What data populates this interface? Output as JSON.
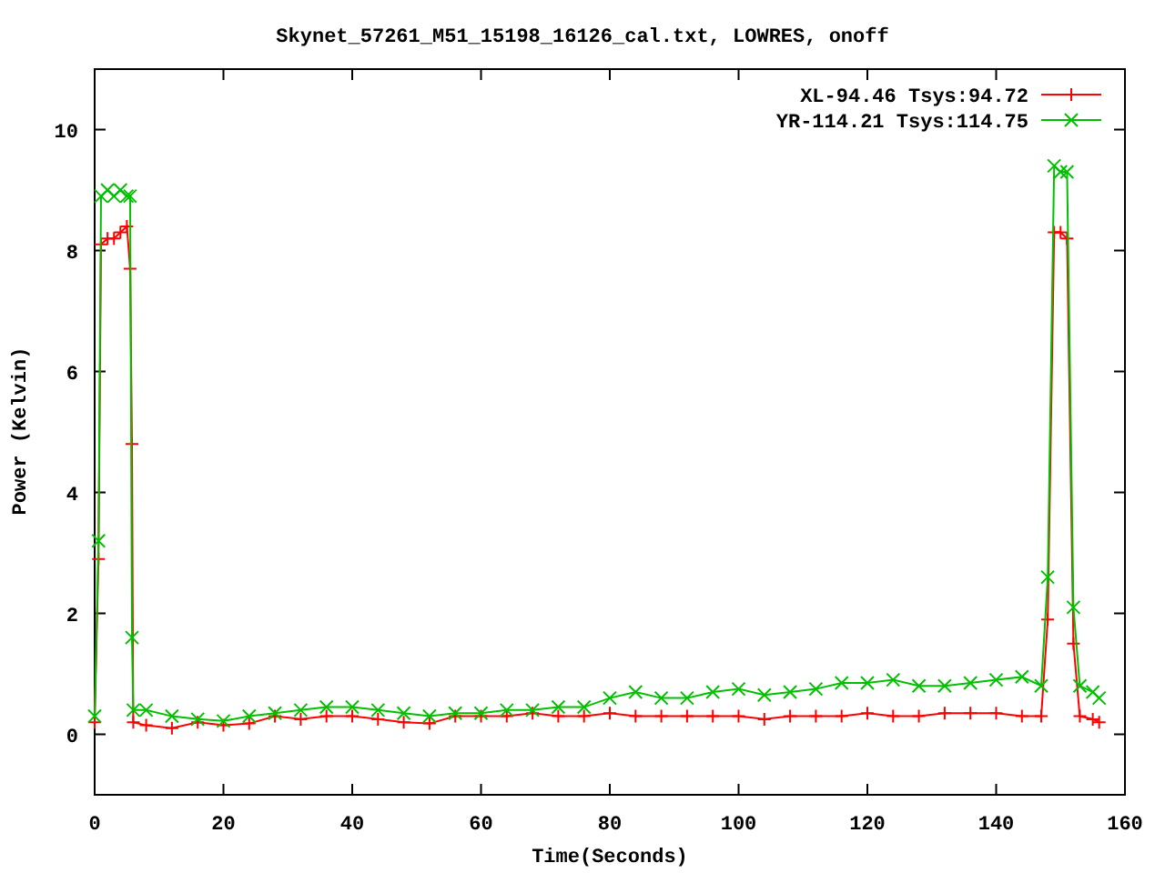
{
  "chart_data": {
    "type": "line",
    "title": "Skynet_57261_M51_15198_16126_cal.txt, LOWRES, onoff",
    "xlabel": "Time(Seconds)",
    "ylabel": "Power (Kelvin)",
    "x": [
      0,
      0.6,
      1,
      2,
      3,
      4,
      5,
      5.5,
      5.8,
      6,
      8,
      12,
      16,
      20,
      24,
      28,
      32,
      36,
      40,
      44,
      48,
      52,
      56,
      60,
      64,
      68,
      72,
      76,
      80,
      84,
      88,
      92,
      96,
      100,
      104,
      108,
      112,
      116,
      120,
      124,
      128,
      132,
      136,
      140,
      144,
      147,
      148,
      149,
      150,
      151,
      152,
      153,
      155,
      156
    ],
    "series": [
      {
        "name": "XL-94.46 Tsys:94.72",
        "color": "#ff0000",
        "marker": "plus",
        "values": [
          0.2,
          2.9,
          8.1,
          8.2,
          8.2,
          8.3,
          8.4,
          7.7,
          4.8,
          0.2,
          0.15,
          0.1,
          0.2,
          0.15,
          0.18,
          0.3,
          0.25,
          0.3,
          0.3,
          0.25,
          0.2,
          0.18,
          0.3,
          0.3,
          0.3,
          0.35,
          0.3,
          0.3,
          0.35,
          0.3,
          0.3,
          0.3,
          0.3,
          0.3,
          0.25,
          0.3,
          0.3,
          0.3,
          0.35,
          0.3,
          0.3,
          0.35,
          0.35,
          0.35,
          0.3,
          0.3,
          1.9,
          8.3,
          8.3,
          8.2,
          1.5,
          0.3,
          0.25,
          0.2
        ]
      },
      {
        "name": "YR-114.21 Tsys:114.75",
        "color": "#00c000",
        "marker": "cross",
        "values": [
          0.3,
          3.2,
          8.9,
          9.0,
          8.9,
          9.0,
          8.9,
          8.9,
          1.6,
          0.4,
          0.4,
          0.3,
          0.25,
          0.22,
          0.3,
          0.35,
          0.4,
          0.45,
          0.45,
          0.4,
          0.35,
          0.3,
          0.35,
          0.35,
          0.4,
          0.4,
          0.45,
          0.45,
          0.6,
          0.7,
          0.6,
          0.6,
          0.7,
          0.75,
          0.65,
          0.7,
          0.75,
          0.85,
          0.85,
          0.9,
          0.8,
          0.8,
          0.85,
          0.9,
          0.95,
          0.8,
          2.6,
          9.4,
          9.3,
          9.3,
          2.1,
          0.8,
          0.7,
          0.6
        ]
      }
    ],
    "legend": true,
    "xlim": [
      0,
      160
    ],
    "ylim": [
      -1,
      11
    ],
    "xticks": [
      0,
      20,
      40,
      60,
      80,
      100,
      120,
      140,
      160
    ],
    "yticks": [
      0,
      2,
      4,
      6,
      8,
      10
    ]
  }
}
